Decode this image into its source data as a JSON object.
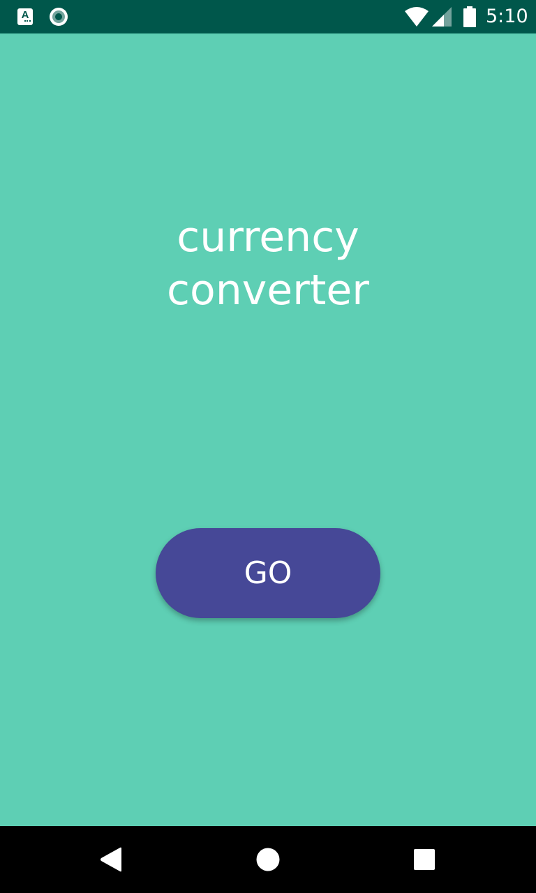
{
  "status_bar": {
    "time": "5:10",
    "app_icon_letter": "A",
    "background_color": "#00574b",
    "icons": [
      "app-a-icon",
      "app-circle-icon",
      "wifi-icon",
      "signal-icon",
      "battery-icon"
    ]
  },
  "main": {
    "background_color": "#5ecfb4",
    "title_line1": "currency",
    "title_line2": "converter",
    "go_label": "GO",
    "go_button_color": "#464897"
  },
  "nav_bar": {
    "icons": [
      "back-icon",
      "home-icon",
      "recents-icon"
    ]
  }
}
